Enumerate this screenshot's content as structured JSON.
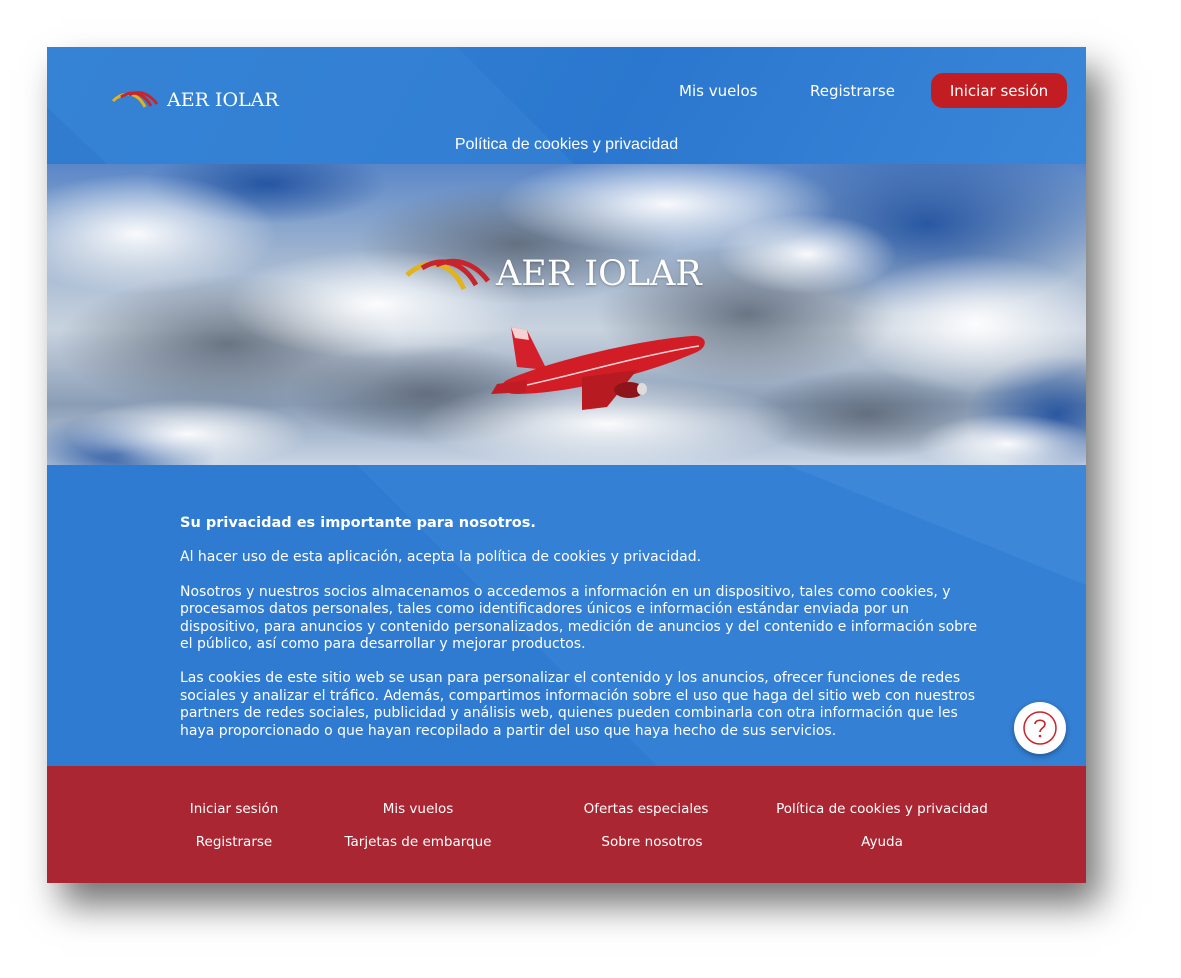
{
  "brand": {
    "name": "AER IOLAR"
  },
  "header": {
    "nav": {
      "my_flights": "Mis vuelos",
      "register": "Registrarse",
      "login": "Iniciar sesión"
    },
    "page_title": "Política de cookies y privacidad"
  },
  "hero": {
    "brand_name": "AER IOLAR"
  },
  "content": {
    "lead": "Su privacidad es importante para nosotros.",
    "paragraphs": [
      "Al hacer uso de esta aplicación, acepta la política de cookies y privacidad.",
      "Nosotros y nuestros socios almacenamos o accedemos a información en un dispositivo, tales como cookies, y procesamos datos personales, tales como identificadores únicos e información estándar enviada por un dispositivo, para anuncios y contenido personalizados, medición de anuncios y del contenido e información sobre el público, así como para desarrollar y mejorar productos.",
      "Las cookies de este sitio web se usan para personalizar el contenido y los anuncios, ofrecer funciones de redes sociales y analizar el tráfico. Además, compartimos información sobre el uso que haga del sitio web con nuestros partners de redes sociales, publicidad y análisis web, quienes pueden combinarla con otra información que les haya proporcionado o que hayan recopilado a partir del uso que haya hecho de sus servicios."
    ]
  },
  "help": {
    "icon": "question-mark-icon"
  },
  "footer": {
    "links": [
      "Iniciar sesión",
      "Mis vuelos",
      "Ofertas especiales",
      "Política de cookies y privacidad",
      "Registrarse",
      "Tarjetas de embarque",
      "Sobre nosotros",
      "Ayuda"
    ]
  },
  "colors": {
    "primary_blue": "#2f7bd1",
    "login_red": "#c21d22",
    "footer_red": "#a92632",
    "logo_red": "#c8242c",
    "logo_yellow": "#e3b21c"
  }
}
